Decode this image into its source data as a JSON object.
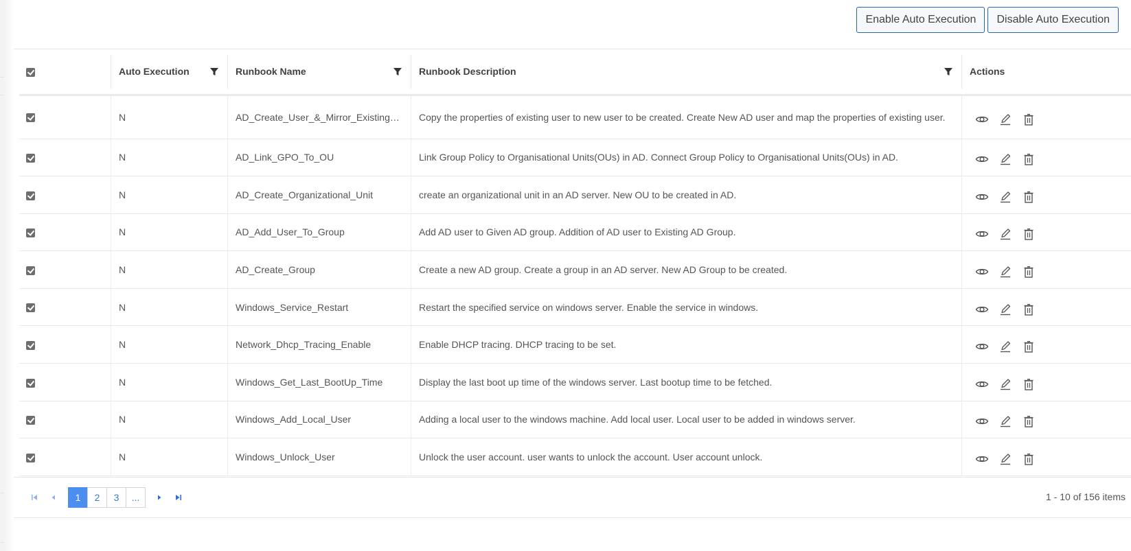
{
  "toolbar": {
    "enable_label": "Enable Auto Execution",
    "disable_label": "Disable Auto Execution"
  },
  "table": {
    "header_checked": true,
    "columns": {
      "auto_execution": "Auto Execution",
      "runbook_name": "Runbook Name",
      "runbook_description": "Runbook Description",
      "actions": "Actions"
    },
    "rows": [
      {
        "checked": true,
        "auto": "N",
        "name": "AD_Create_User_&_Mirror_Existing_User",
        "description": "Copy the properties of existing user to new user to be created. Create New AD user and map the properties of existing user."
      },
      {
        "checked": true,
        "auto": "N",
        "name": "AD_Link_GPO_To_OU",
        "description": "Link Group Policy to Organisational Units(OUs) in AD. Connect Group Policy to Organisational Units(OUs) in AD."
      },
      {
        "checked": true,
        "auto": "N",
        "name": "AD_Create_Organizational_Unit",
        "description": "create an organizational unit in an AD server. New OU to be created in AD."
      },
      {
        "checked": true,
        "auto": "N",
        "name": "AD_Add_User_To_Group",
        "description": "Add AD user to Given AD group. Addition of AD user to Existing AD Group."
      },
      {
        "checked": true,
        "auto": "N",
        "name": "AD_Create_Group",
        "description": "Create a new AD group. Create a group in an AD server. New AD Group to be created."
      },
      {
        "checked": true,
        "auto": "N",
        "name": "Windows_Service_Restart",
        "description": "Restart the specified service on windows server. Enable the service in windows."
      },
      {
        "checked": true,
        "auto": "N",
        "name": "Network_Dhcp_Tracing_Enable",
        "description": "Enable DHCP tracing. DHCP tracing to be set."
      },
      {
        "checked": true,
        "auto": "N",
        "name": "Windows_Get_Last_BootUp_Time",
        "description": "Display the last boot up time of the windows server. Last bootup time to be fetched."
      },
      {
        "checked": true,
        "auto": "N",
        "name": "Windows_Add_Local_User",
        "description": "Adding a local user to the windows machine. Add local user. Local user to be added in windows server."
      },
      {
        "checked": true,
        "auto": "N",
        "name": "Windows_Unlock_User",
        "description": "Unlock the user account. user wants to unlock the account. User account unlock."
      }
    ],
    "row_actions": [
      "eye-icon",
      "pencil-icon",
      "trash-icon"
    ]
  },
  "pager": {
    "pages": [
      "1",
      "2",
      "3",
      "..."
    ],
    "current_page": "1",
    "info": "1 - 10 of 156 items"
  },
  "colors": {
    "accent": "#4c8ef0",
    "button_border": "#2a62b8",
    "checkbox": "#6d6d6d"
  }
}
